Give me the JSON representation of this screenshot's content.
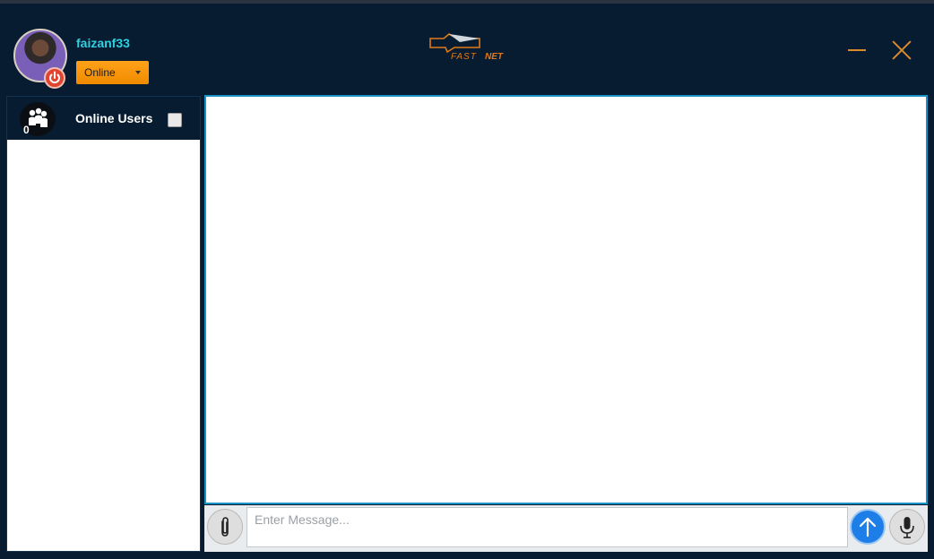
{
  "user": {
    "name": "faizanf33",
    "status": "Online"
  },
  "logo": {
    "word1": "FAST",
    "word2": "NET"
  },
  "sidebar": {
    "title": "Online Users",
    "count": "0"
  },
  "compose": {
    "placeholder": "Enter Message..."
  },
  "colors": {
    "background": "#071c31",
    "accent_orange": "#f08a00",
    "username": "#2fd0e0",
    "chat_border": "#1a92c6",
    "send_button": "#1e7ee8"
  },
  "icons": {
    "power": "power-icon",
    "minimize": "minimize-icon",
    "close": "close-icon",
    "users": "users-group-icon",
    "attach": "paperclip-icon",
    "send": "arrow-up-icon",
    "mic": "microphone-icon"
  }
}
